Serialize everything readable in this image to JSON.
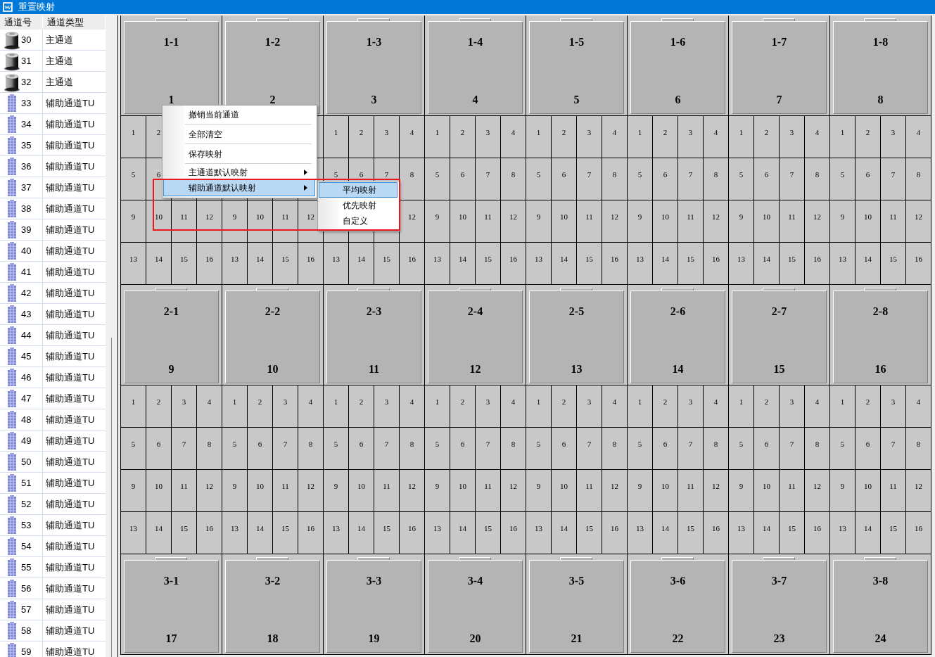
{
  "window": {
    "title": "重置映射"
  },
  "channel_list": {
    "columns": [
      "通道号",
      "通道类型"
    ],
    "rows": [
      {
        "kind": "main",
        "number": "30",
        "type": "主通道"
      },
      {
        "kind": "main",
        "number": "31",
        "type": "主通道"
      },
      {
        "kind": "main",
        "number": "32",
        "type": "主通道"
      },
      {
        "kind": "aux",
        "number": "33",
        "type": "辅助通道TU"
      },
      {
        "kind": "aux",
        "number": "34",
        "type": "辅助通道TU"
      },
      {
        "kind": "aux",
        "number": "35",
        "type": "辅助通道TU"
      },
      {
        "kind": "aux",
        "number": "36",
        "type": "辅助通道TU"
      },
      {
        "kind": "aux",
        "number": "37",
        "type": "辅助通道TU"
      },
      {
        "kind": "aux",
        "number": "38",
        "type": "辅助通道TU"
      },
      {
        "kind": "aux",
        "number": "39",
        "type": "辅助通道TU"
      },
      {
        "kind": "aux",
        "number": "40",
        "type": "辅助通道TU"
      },
      {
        "kind": "aux",
        "number": "41",
        "type": "辅助通道TU"
      },
      {
        "kind": "aux",
        "number": "42",
        "type": "辅助通道TU"
      },
      {
        "kind": "aux",
        "number": "43",
        "type": "辅助通道TU"
      },
      {
        "kind": "aux",
        "number": "44",
        "type": "辅助通道TU"
      },
      {
        "kind": "aux",
        "number": "45",
        "type": "辅助通道TU"
      },
      {
        "kind": "aux",
        "number": "46",
        "type": "辅助通道TU"
      },
      {
        "kind": "aux",
        "number": "47",
        "type": "辅助通道TU"
      },
      {
        "kind": "aux",
        "number": "48",
        "type": "辅助通道TU"
      },
      {
        "kind": "aux",
        "number": "49",
        "type": "辅助通道TU"
      },
      {
        "kind": "aux",
        "number": "50",
        "type": "辅助通道TU"
      },
      {
        "kind": "aux",
        "number": "51",
        "type": "辅助通道TU"
      },
      {
        "kind": "aux",
        "number": "52",
        "type": "辅助通道TU"
      },
      {
        "kind": "aux",
        "number": "53",
        "type": "辅助通道TU"
      },
      {
        "kind": "aux",
        "number": "54",
        "type": "辅助通道TU"
      },
      {
        "kind": "aux",
        "number": "55",
        "type": "辅助通道TU"
      },
      {
        "kind": "aux",
        "number": "56",
        "type": "辅助通道TU"
      },
      {
        "kind": "aux",
        "number": "57",
        "type": "辅助通道TU"
      },
      {
        "kind": "aux",
        "number": "58",
        "type": "辅助通道TU"
      },
      {
        "kind": "aux",
        "number": "59",
        "type": "辅助通道TU"
      }
    ]
  },
  "modules": [
    {
      "title": "1-1",
      "number": "1",
      "cells": [
        "1",
        "2",
        null,
        null,
        "5",
        "6",
        null,
        null,
        "9",
        "10",
        "11",
        "12",
        "13",
        "14",
        "15",
        "16"
      ]
    },
    {
      "title": "1-2",
      "number": "2",
      "cells": [
        null,
        null,
        null,
        null,
        null,
        null,
        null,
        null,
        "9",
        "10",
        "11",
        "12",
        "13",
        "14",
        "15",
        "16"
      ]
    },
    {
      "title": "1-3",
      "number": "3",
      "cells": [
        "1",
        "2",
        "3",
        "4",
        "5",
        "6",
        "7",
        "8",
        null,
        null,
        null,
        "12",
        "13",
        "14",
        "15",
        "16"
      ]
    },
    {
      "title": "1-4",
      "number": "4",
      "cells": [
        "1",
        "2",
        "3",
        "4",
        "5",
        "6",
        "7",
        "8",
        "9",
        "10",
        "11",
        "12",
        "13",
        "14",
        "15",
        "16"
      ]
    },
    {
      "title": "1-5",
      "number": "5",
      "cells": [
        "1",
        "2",
        "3",
        "4",
        "5",
        "6",
        "7",
        "8",
        "9",
        "10",
        "11",
        "12",
        "13",
        "14",
        "15",
        "16"
      ]
    },
    {
      "title": "1-6",
      "number": "6",
      "cells": [
        "1",
        "2",
        "3",
        "4",
        "5",
        "6",
        "7",
        "8",
        "9",
        "10",
        "11",
        "12",
        "13",
        "14",
        "15",
        "16"
      ]
    },
    {
      "title": "1-7",
      "number": "7",
      "cells": [
        "1",
        "2",
        "3",
        "4",
        "5",
        "6",
        "7",
        "8",
        "9",
        "10",
        "11",
        "12",
        "13",
        "14",
        "15",
        "16"
      ]
    },
    {
      "title": "1-8",
      "number": "8",
      "cells": [
        "1",
        "2",
        "3",
        "4",
        "5",
        "6",
        "7",
        "8",
        "9",
        "10",
        "11",
        "12",
        "13",
        "14",
        "15",
        "16"
      ]
    },
    {
      "title": "2-1",
      "number": "9",
      "cells": [
        "1",
        "2",
        "3",
        "4",
        "5",
        "6",
        "7",
        "8",
        "9",
        "10",
        "11",
        "12",
        "13",
        "14",
        "15",
        "16"
      ]
    },
    {
      "title": "2-2",
      "number": "10",
      "cells": [
        "1",
        "2",
        "3",
        "4",
        "5",
        "6",
        "7",
        "8",
        "9",
        "10",
        "11",
        "12",
        "13",
        "14",
        "15",
        "16"
      ]
    },
    {
      "title": "2-3",
      "number": "11",
      "cells": [
        "1",
        "2",
        "3",
        "4",
        "5",
        "6",
        "7",
        "8",
        "9",
        "10",
        "11",
        "12",
        "13",
        "14",
        "15",
        "16"
      ]
    },
    {
      "title": "2-4",
      "number": "12",
      "cells": [
        "1",
        "2",
        "3",
        "4",
        "5",
        "6",
        "7",
        "8",
        "9",
        "10",
        "11",
        "12",
        "13",
        "14",
        "15",
        "16"
      ]
    },
    {
      "title": "2-5",
      "number": "13",
      "cells": [
        "1",
        "2",
        "3",
        "4",
        "5",
        "6",
        "7",
        "8",
        "9",
        "10",
        "11",
        "12",
        "13",
        "14",
        "15",
        "16"
      ]
    },
    {
      "title": "2-6",
      "number": "14",
      "cells": [
        "1",
        "2",
        "3",
        "4",
        "5",
        "6",
        "7",
        "8",
        "9",
        "10",
        "11",
        "12",
        "13",
        "14",
        "15",
        "16"
      ]
    },
    {
      "title": "2-7",
      "number": "15",
      "cells": [
        "1",
        "2",
        "3",
        "4",
        "5",
        "6",
        "7",
        "8",
        "9",
        "10",
        "11",
        "12",
        "13",
        "14",
        "15",
        "16"
      ]
    },
    {
      "title": "2-8",
      "number": "16",
      "cells": [
        "1",
        "2",
        "3",
        "4",
        "5",
        "6",
        "7",
        "8",
        "9",
        "10",
        "11",
        "12",
        "13",
        "14",
        "15",
        "16"
      ]
    },
    {
      "title": "3-1",
      "number": "17"
    },
    {
      "title": "3-2",
      "number": "18"
    },
    {
      "title": "3-3",
      "number": "19"
    },
    {
      "title": "3-4",
      "number": "20"
    },
    {
      "title": "3-5",
      "number": "21"
    },
    {
      "title": "3-6",
      "number": "22"
    },
    {
      "title": "3-7",
      "number": "23"
    },
    {
      "title": "3-8",
      "number": "24"
    }
  ],
  "context_menu": {
    "items": [
      {
        "label": "撤销当前通道",
        "submenu": false,
        "selected": false,
        "separator_after": true
      },
      {
        "label": "全部清空",
        "submenu": false,
        "selected": false,
        "separator_after": true
      },
      {
        "label": "保存映射",
        "submenu": false,
        "selected": false,
        "separator_after": true
      },
      {
        "label": "主通道默认映射",
        "submenu": true,
        "selected": false,
        "separator_after": false
      },
      {
        "label": "辅助通道默认映射",
        "submenu": true,
        "selected": true,
        "separator_after": false
      }
    ],
    "submenu": {
      "items": [
        {
          "label": "平均映射",
          "selected": true
        },
        {
          "label": "优先映射",
          "selected": false
        },
        {
          "label": "自定义",
          "selected": false
        }
      ]
    },
    "highlight_frame": true
  }
}
